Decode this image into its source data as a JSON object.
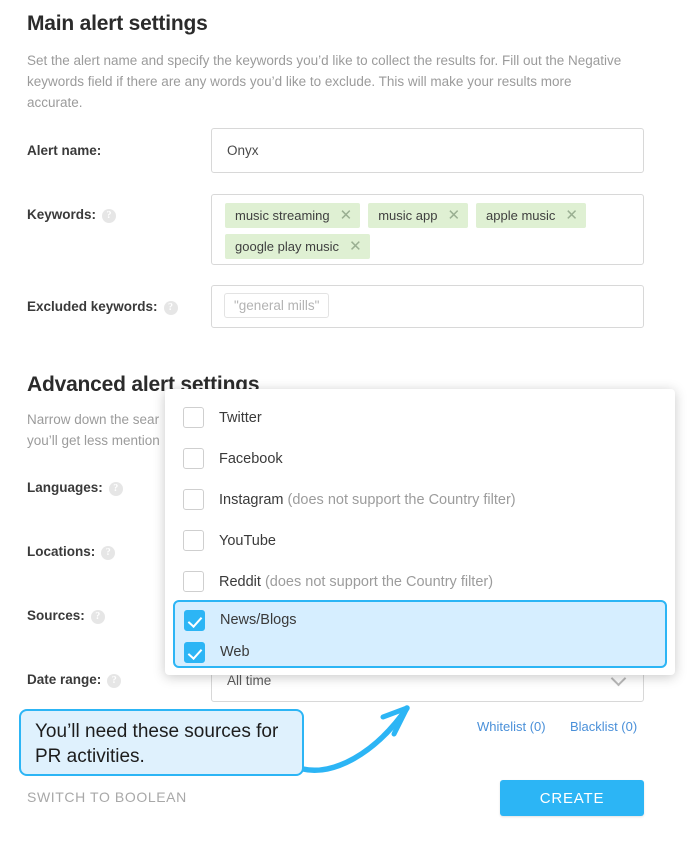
{
  "main_section": {
    "title": "Main alert settings",
    "description": "Set the alert name and specify the keywords you’d like to collect the results for. Fill out the Negative keywords field if there are any words you’d like to exclude. This will make your results more accurate."
  },
  "fields": {
    "alert_name": {
      "label": "Alert name:",
      "value": "Onyx"
    },
    "keywords": {
      "label": "Keywords:",
      "help": "?",
      "tags": [
        "music streaming",
        "music app",
        "apple music",
        "google play music"
      ],
      "remove_glyph": "✕"
    },
    "excluded_keywords": {
      "label": "Excluded keywords:",
      "help": "?",
      "placeholder": "\"general mills\""
    }
  },
  "advanced_section": {
    "title": "Advanced alert settings",
    "description_line1": "Narrow down the sear",
    "description_line2": "you’ll get less mention",
    "labels": {
      "languages": "Languages:",
      "locations": "Locations:",
      "sources": "Sources:",
      "date_range": "Date range:"
    },
    "help": "?",
    "date_range_value": "All time"
  },
  "sources_dropdown": {
    "options": [
      {
        "label": "Twitter",
        "note": "",
        "checked": false
      },
      {
        "label": "Facebook",
        "note": "",
        "checked": false
      },
      {
        "label": "Instagram",
        "note": " (does not support the Country filter)",
        "checked": false
      },
      {
        "label": "YouTube",
        "note": "",
        "checked": false
      },
      {
        "label": "Reddit",
        "note": " (does not support the Country filter)",
        "checked": false
      }
    ],
    "highlighted_options": [
      {
        "label": "News/Blogs",
        "note": "",
        "checked": true
      },
      {
        "label": "Web",
        "note": "",
        "checked": true
      }
    ]
  },
  "footer": {
    "whitelist": "Whitelist (0)",
    "blacklist": "Blacklist (0)",
    "switch_boolean": "SWITCH TO BOOLEAN",
    "create": "CREATE"
  },
  "annotation": {
    "callout_text": "You’ll need these sources for PR activities."
  },
  "colors": {
    "accent_blue": "#2cb5f5",
    "link_blue": "#4a90d9",
    "tag_green": "#dff0d3",
    "callout_fill": "#dff1fd",
    "highlight_fill": "#d6eeff"
  }
}
